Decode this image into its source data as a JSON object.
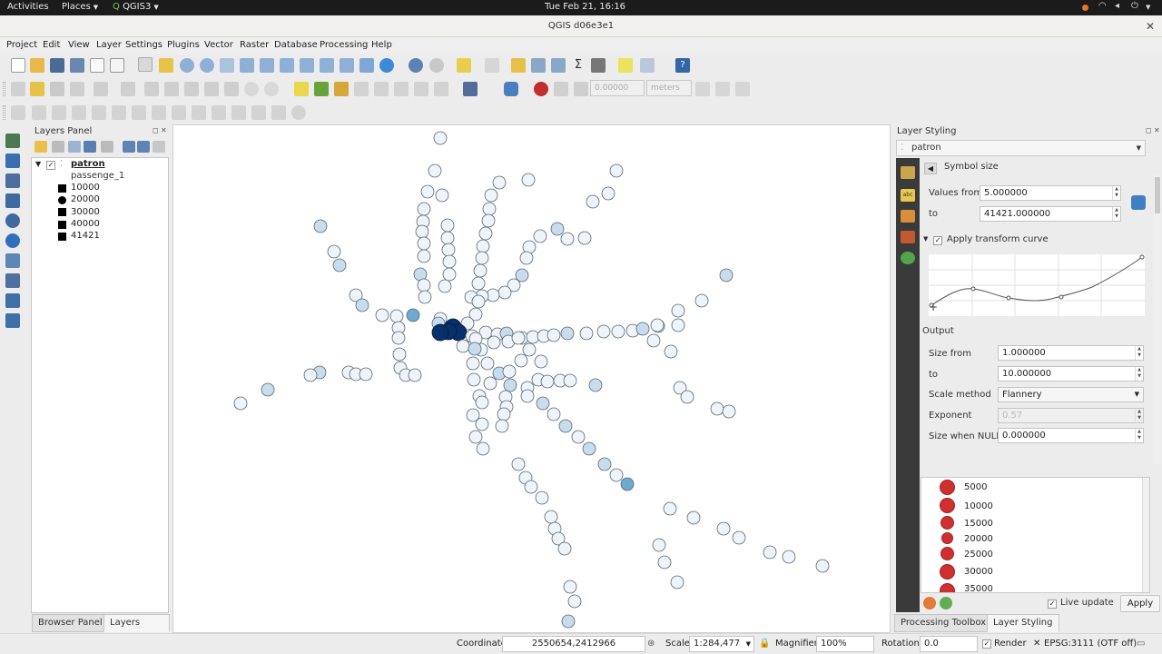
{
  "system_bar": {
    "activities": "Activities",
    "places": "Places",
    "app": "QGIS3",
    "clock": "Tue Feb 21, 16:16"
  },
  "window": {
    "title": "QGIS d06e3e1"
  },
  "menu": [
    "Project",
    "Edit",
    "View",
    "Layer",
    "Settings",
    "Plugins",
    "Vector",
    "Raster",
    "Database",
    "Processing",
    "Help"
  ],
  "digitizing": {
    "snap_tolerance": "0.00000",
    "units": "meters"
  },
  "layers_panel": {
    "title": "Layers Panel",
    "layer_name": "patron",
    "field_name": "passenge_1",
    "legend": [
      "10000",
      "20000",
      "30000",
      "40000",
      "41421"
    ],
    "tabs": [
      "Browser Panel",
      "Layers Panel"
    ]
  },
  "styling": {
    "title": "Layer Styling",
    "layer": "patron",
    "section": "Symbol size",
    "values_from_label": "Values from",
    "values_from": "5.000000",
    "to_label": "to",
    "values_to": "41421.000000",
    "transform_curve_label": "Apply transform curve",
    "output_label": "Output",
    "size_from_label": "Size from",
    "size_from": "1.000000",
    "size_to_label": "to",
    "size_to": "10.000000",
    "scale_method_label": "Scale method",
    "scale_method": "Flannery",
    "exponent_label": "Exponent",
    "exponent": "0.57",
    "null_label": "Size when NULL",
    "size_null": "0.000000",
    "legend_values": [
      "5000",
      "10000",
      "15000",
      "20000",
      "25000",
      "30000",
      "35000"
    ],
    "live_update": "Live update",
    "apply": "Apply",
    "tabs": [
      "Processing Toolbox",
      "Layer Styling"
    ],
    "symbol_color": "#d12f2f"
  },
  "status": {
    "coordinate_label": "Coordinate",
    "coordinate": "2550654,2412966",
    "scale_label": "Scale",
    "scale": "1:284,477",
    "magnifier_label": "Magnifier",
    "magnifier": "100%",
    "rotation_label": "Rotation",
    "rotation": "0.0",
    "render_label": "Render",
    "crs": "EPSG:3111 (OTF off)"
  },
  "colors": {
    "fill_light": "#eef4fa",
    "fill_mid": "#c8dcec",
    "fill_blue": "#6fa9cf",
    "fill_dark": "#08306b",
    "stroke": "#5a6773"
  }
}
